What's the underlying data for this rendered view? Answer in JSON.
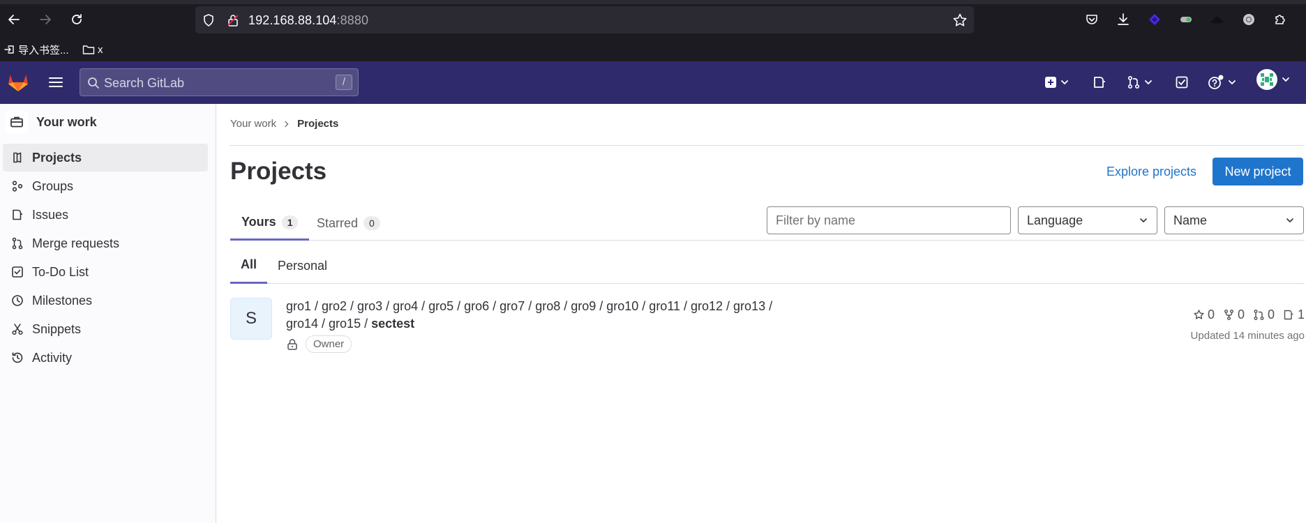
{
  "browser": {
    "url_host": "192.168.88.104",
    "url_port": ":8880",
    "bookmarks": [
      {
        "label": "导入书签..."
      },
      {
        "label": "x"
      }
    ]
  },
  "header": {
    "search_placeholder": "Search GitLab",
    "search_shortcut": "/"
  },
  "sidebar": {
    "context_label": "Your work",
    "items": [
      {
        "label": "Projects",
        "icon": "project-icon",
        "active": true
      },
      {
        "label": "Groups",
        "icon": "group-icon"
      },
      {
        "label": "Issues",
        "icon": "issues-icon"
      },
      {
        "label": "Merge requests",
        "icon": "merge-request-icon"
      },
      {
        "label": "To-Do List",
        "icon": "todo-icon"
      },
      {
        "label": "Milestones",
        "icon": "clock-icon"
      },
      {
        "label": "Snippets",
        "icon": "snippet-icon"
      },
      {
        "label": "Activity",
        "icon": "history-icon"
      }
    ]
  },
  "main": {
    "breadcrumb": {
      "parent": "Your work",
      "current": "Projects"
    },
    "title": "Projects",
    "explore_label": "Explore projects",
    "new_project_label": "New project",
    "tabs": [
      {
        "label": "Yours",
        "count": "1",
        "active": true
      },
      {
        "label": "Starred",
        "count": "0"
      }
    ],
    "filter_placeholder": "Filter by name",
    "language_dropdown": "Language",
    "sort_dropdown": "Name",
    "subtabs": [
      {
        "label": "All",
        "active": true
      },
      {
        "label": "Personal"
      }
    ],
    "project": {
      "avatar_letter": "S",
      "path_line1": "gro1 / gro2 / gro3 / gro4 / gro5 / gro6 / gro7 / gro8 / gro9 / gro10 / gro11 / gro12 / gro13 /",
      "path_line2_prefix": "gro14 / gro15 / ",
      "name": "sectest",
      "role": "Owner",
      "stars": "0",
      "forks": "0",
      "merge_requests": "0",
      "issues": "1",
      "updated": "Updated 14 minutes ago"
    }
  },
  "colors": {
    "header_bg": "#2f2a6b",
    "primary": "#1f75cb",
    "tab_underline": "#6666c4"
  }
}
